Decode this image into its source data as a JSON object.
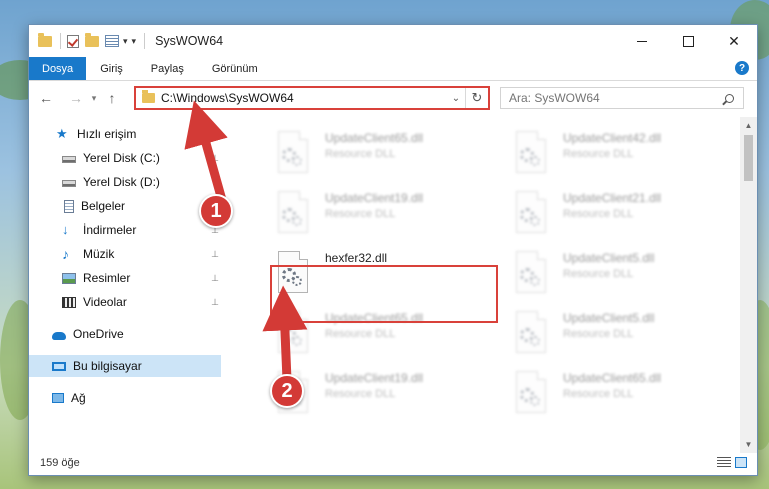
{
  "window": {
    "title": "SysWOW64",
    "ribbon_tabs": [
      "Dosya",
      "Giriş",
      "Paylaş",
      "Görünüm"
    ],
    "help_label": "?"
  },
  "address": {
    "path": "C:\\Windows\\SysWOW64"
  },
  "search": {
    "placeholder": "Ara: SysWOW64"
  },
  "nav_pane": [
    {
      "label": "Hızlı erişim",
      "icon": "star-icon"
    },
    {
      "label": "Yerel Disk (C:)",
      "icon": "drive-icon"
    },
    {
      "label": "Yerel Disk (D:)",
      "icon": "drive-icon"
    },
    {
      "label": "Belgeler",
      "icon": "documents-icon"
    },
    {
      "label": "İndirmeler",
      "icon": "downloads-icon"
    },
    {
      "label": "Müzik",
      "icon": "music-icon"
    },
    {
      "label": "Resimler",
      "icon": "pictures-icon"
    },
    {
      "label": "Videolar",
      "icon": "videos-icon"
    },
    {
      "label": "OneDrive",
      "icon": "cloud-icon"
    },
    {
      "label": "Bu bilgisayar",
      "icon": "computer-icon"
    },
    {
      "label": "Ağ",
      "icon": "network-icon"
    }
  ],
  "files": [
    {
      "name": "UpdateClient65.dll",
      "type": "Resource DLL"
    },
    {
      "name": "UpdateClient42.dll",
      "type": "Resource DLL"
    },
    {
      "name": "UpdateClient19.dll",
      "type": "Resource DLL"
    },
    {
      "name": "UpdateClient21.dll",
      "type": "Resource DLL"
    },
    {
      "name": "hexfer32.dll",
      "type": ""
    },
    {
      "name": "UpdateClient5.dll",
      "type": "Resource DLL"
    },
    {
      "name": "UpdateClient65.dll",
      "type": "Resource DLL"
    },
    {
      "name": "UpdateClient5.dll",
      "type": "Resource DLL"
    },
    {
      "name": "UpdateClient19.dll",
      "type": "Resource DLL"
    },
    {
      "name": "UpdateClient65.dll",
      "type": "Resource DLL"
    }
  ],
  "status": {
    "item_count": "159 öğe"
  },
  "callouts": [
    "1",
    "2"
  ],
  "colors": {
    "accent": "#1979ca",
    "highlight": "#d9413a",
    "folder": "#e9c15a"
  }
}
